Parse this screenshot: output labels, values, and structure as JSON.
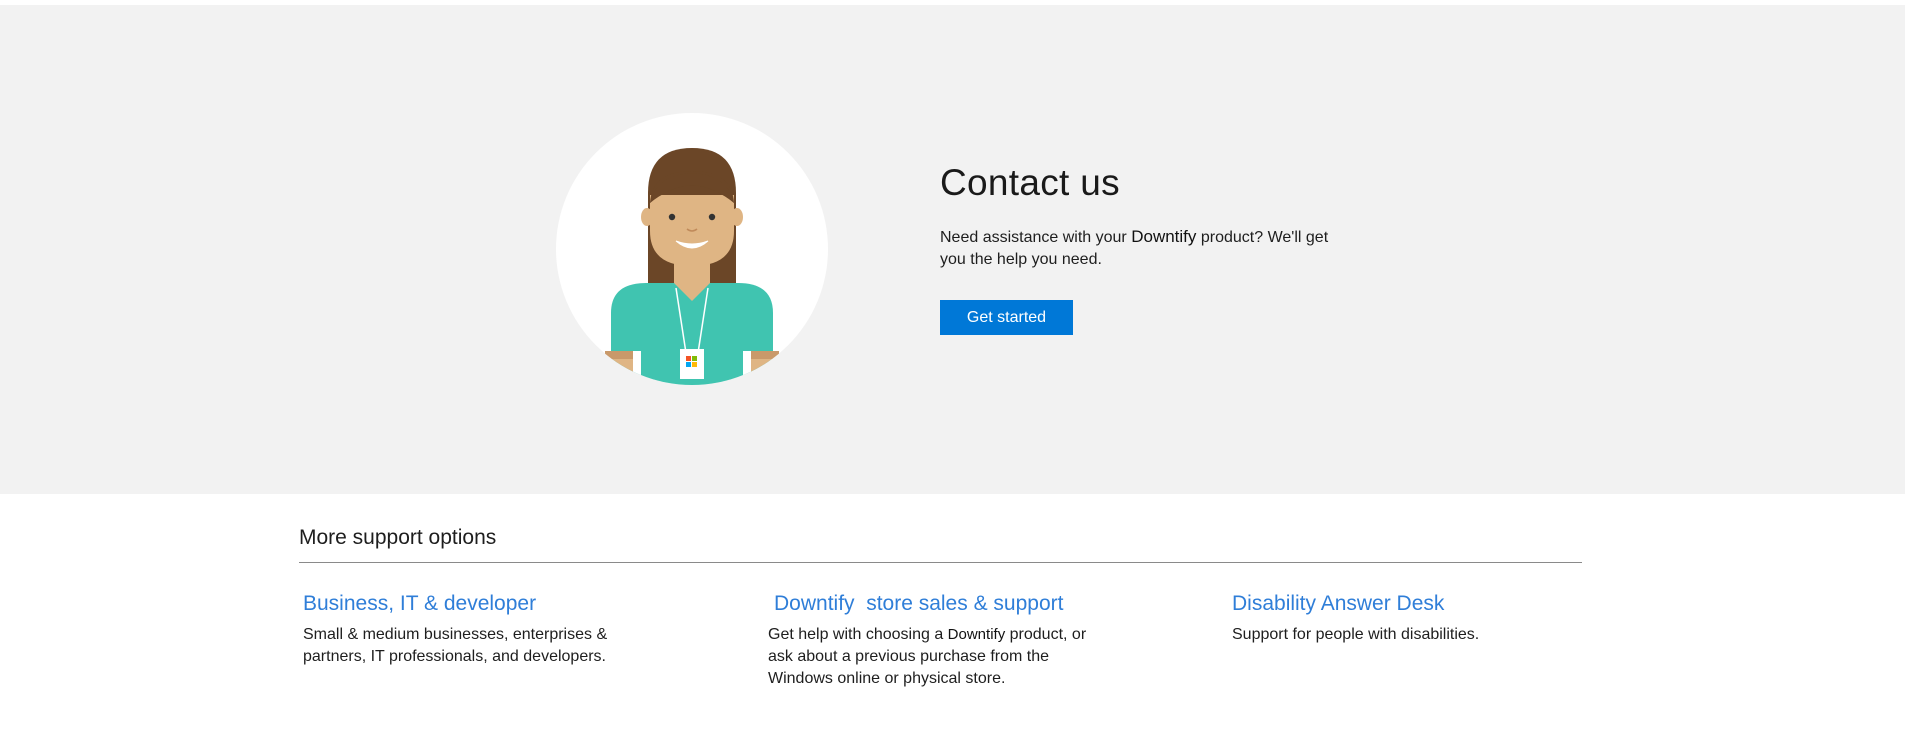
{
  "hero": {
    "title": "Contact us",
    "desc_before": "Need assistance with your",
    "desc_brand": "Downtify",
    "desc_after": "product? We'll get you the help you need.",
    "button_label": "Get started",
    "accent_color": "#0078d7"
  },
  "more": {
    "title": "More support options",
    "options": [
      {
        "title": "Business, IT & developer",
        "desc": "Small & medium businesses, enterprises & partners, IT professionals, and developers."
      },
      {
        "title": "Downtify  store sales & support",
        "desc_before": "Get help with choosing a",
        "desc_brand": "Downtify",
        "desc_after": "product, or ask about a previous purchase from the Windows online or physical store."
      },
      {
        "title": "Disability Answer Desk",
        "desc": "Support for people with disabilities."
      }
    ],
    "link_color": "#2f7ed8"
  },
  "icons": {
    "avatar": "support-agent-illustration",
    "badge": "windows-logo-badge"
  }
}
